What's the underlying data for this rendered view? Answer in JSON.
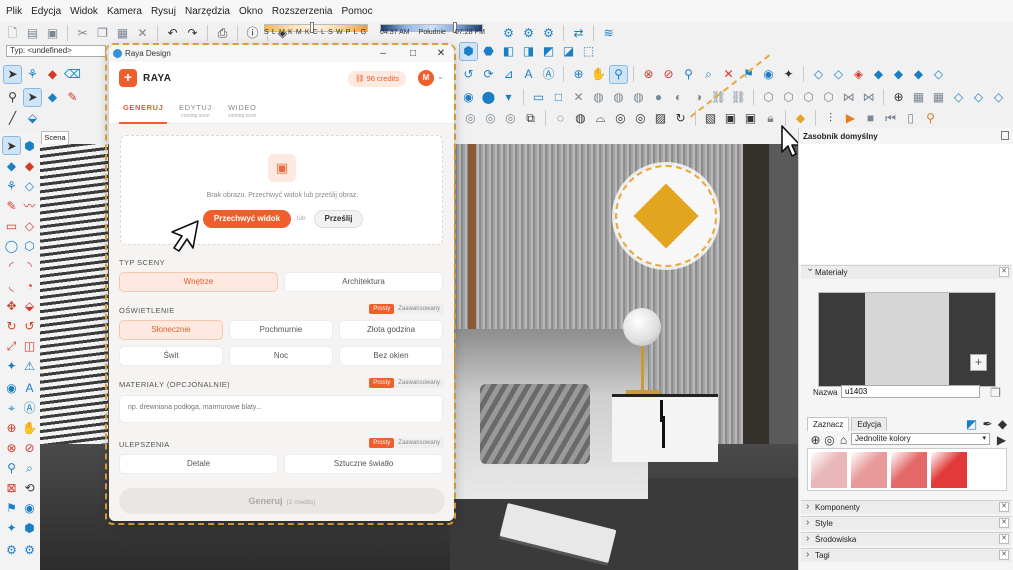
{
  "menu": [
    "Plik",
    "Edycja",
    "Widok",
    "Kamera",
    "Rysuj",
    "Narzędzia",
    "Okno",
    "Rozszerzenia",
    "Pomoc"
  ],
  "toolbar": {
    "type_field": "Typ: <undefined>",
    "shadow_months": "SLMKMKCLSWPLG",
    "time_start": "04:37 AM",
    "time_mid": "Południe",
    "time_end": "07:28 PM"
  },
  "scene": {
    "tab_label": "Scena 1"
  },
  "dialog": {
    "window_title": "Raya Design",
    "app_name": "RAYA",
    "credits": "96 credits",
    "avatar_initial": "M",
    "tabs": [
      {
        "label": "GENERUJ",
        "sub": ""
      },
      {
        "label": "EDYTUJ",
        "sub": "coming soon"
      },
      {
        "label": "WIDEO",
        "sub": "coming soon"
      }
    ],
    "dropzone": {
      "text": "Brak obrazu. Przechwyć widok lub prześlij obraz.",
      "capture_button": "Przechwyć widok",
      "or": "lub",
      "upload_button": "Prześlij"
    },
    "scene_type": {
      "label": "TYP SCENY",
      "options": [
        "Wnętrze",
        "Architektura"
      ],
      "selected": "Wnętrze"
    },
    "lighting": {
      "label": "OŚWIETLENIE",
      "mode_simple": "Prosty",
      "mode_advanced": "Zaawansowany",
      "options": [
        "Słonecznie",
        "Pochmurnie",
        "Złota godzina",
        "Świt",
        "Noc",
        "Bez okien"
      ],
      "selected": "Słonecznie"
    },
    "materials": {
      "label": "MATERIAŁY (OPCJONALNIE)",
      "mode_simple": "Prosty",
      "mode_advanced": "Zaawansowany",
      "placeholder": "np. drewniana podłoga, marmurowe blaty..."
    },
    "enhancements": {
      "label": "ULEPSZENIA",
      "mode_simple": "Prosty",
      "mode_advanced": "Zaawansowany",
      "options": [
        "Detale",
        "Sztuczne światło"
      ]
    },
    "generate": {
      "label": "Generuj",
      "cost": "(2 credits)"
    }
  },
  "tray": {
    "title": "Zasobnik domyślny",
    "materials": {
      "title": "Materiały",
      "name_label": "Nazwa",
      "name_value": "u1403",
      "tabs": [
        "Zaznacz",
        "Edycja"
      ],
      "active_tab": "Zaznacz",
      "library": "Jednolite kolory",
      "swatch_colors": [
        "#e9b7b7",
        "#e89a9a",
        "#e46a6a",
        "#e23a3a"
      ]
    },
    "panels": [
      "Komponenty",
      "Style",
      "Środowiska",
      "Tagi"
    ]
  },
  "colors": {
    "accent": "#ef5e2b",
    "highlight": "#e8a93a",
    "diamond": "#e3a420"
  }
}
